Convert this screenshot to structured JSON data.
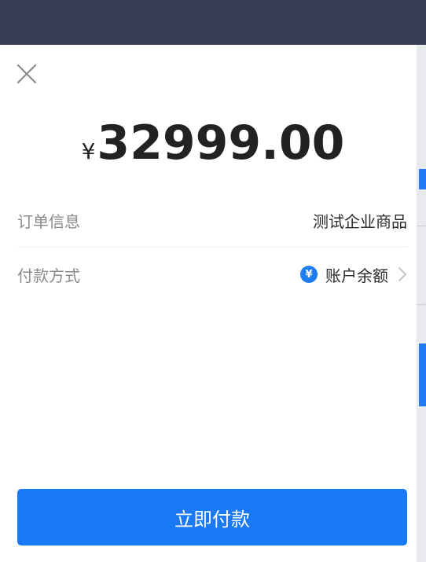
{
  "payment": {
    "currency_symbol": "¥",
    "amount": "32999.00"
  },
  "order_info": {
    "label": "订单信息",
    "value": "测试企业商品"
  },
  "payment_method": {
    "label": "付款方式",
    "badge": "¥",
    "value": "账户余额"
  },
  "actions": {
    "pay_label": "立即付款"
  },
  "colors": {
    "accent": "#1a79f4",
    "overlay": "#343d55"
  },
  "icons": [
    "close-icon",
    "yen-icon",
    "chevron-right-icon"
  ]
}
